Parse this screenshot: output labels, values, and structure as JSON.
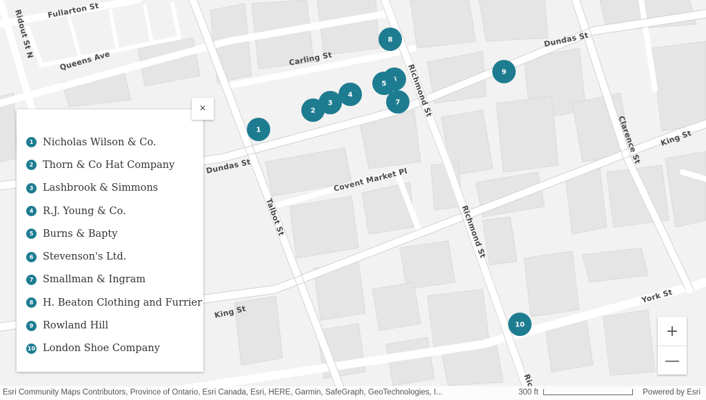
{
  "map": {
    "streets": [
      {
        "id": "fullarton",
        "label": "Fullarton St"
      },
      {
        "id": "ridout",
        "label": "Ridout St N"
      },
      {
        "id": "queens",
        "label": "Queens Ave"
      },
      {
        "id": "carling",
        "label": "Carling St"
      },
      {
        "id": "dundas-west",
        "label": "Dundas St"
      },
      {
        "id": "dundas-east",
        "label": "Dundas St"
      },
      {
        "id": "richmond-north",
        "label": "Richmond St"
      },
      {
        "id": "richmond-south",
        "label": "Richmond St"
      },
      {
        "id": "clarence",
        "label": "Clarence St"
      },
      {
        "id": "king-east",
        "label": "King St"
      },
      {
        "id": "king-west",
        "label": "King St"
      },
      {
        "id": "covent",
        "label": "Covent Market Pl"
      },
      {
        "id": "talbot",
        "label": "Talbot St"
      },
      {
        "id": "york",
        "label": "York St"
      },
      {
        "id": "richmond-bottom",
        "label": "Ric"
      }
    ],
    "markers": [
      "1",
      "2",
      "3",
      "4",
      "5",
      "6",
      "7",
      "8",
      "9",
      "10"
    ],
    "accent_color": "#1e7c91"
  },
  "legend": {
    "close_label": "×",
    "items": [
      {
        "num": "1",
        "label": "Nicholas Wilson & Co."
      },
      {
        "num": "2",
        "label": "Thorn & Co Hat Company"
      },
      {
        "num": "3",
        "label": "Lashbrook & Simmons"
      },
      {
        "num": "4",
        "label": "R.J. Young & Co."
      },
      {
        "num": "5",
        "label": "Burns & Bapty"
      },
      {
        "num": "6",
        "label": "Stevenson's Ltd."
      },
      {
        "num": "7",
        "label": "Smallman & Ingram"
      },
      {
        "num": "8",
        "label": "H. Beaton Clothing and Furrier"
      },
      {
        "num": "9",
        "label": "Rowland Hill"
      },
      {
        "num": "10",
        "label": "London Shoe Company"
      }
    ]
  },
  "zoom": {
    "in_label": "+",
    "out_label": "—"
  },
  "footer": {
    "attribution": "Esri Community Maps Contributors, Province of Ontario, Esri Canada, Esri, HERE, Garmin, SafeGraph, GeoTechnologies, I...",
    "scale": "300 ft",
    "powered_by": "Powered by Esri"
  }
}
